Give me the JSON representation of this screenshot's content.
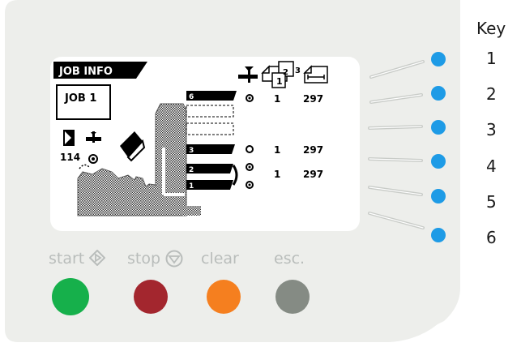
{
  "lcd": {
    "header": "JOB INFO",
    "job_name": "JOB  1",
    "counter": "114",
    "rows": [
      {
        "station": "6",
        "qty": "1",
        "size": "297"
      },
      {
        "station": "3",
        "qty": "1",
        "size": "297"
      },
      {
        "station": "2-1",
        "qty": "1",
        "size": "297"
      }
    ],
    "tray_labels": [
      "6",
      "3",
      "2",
      "1"
    ]
  },
  "buttons": {
    "start_label": "start",
    "stop_label": "stop",
    "clear_label": "clear",
    "esc_label": "esc.",
    "start_color": "#16b04b",
    "stop_color": "#a3262e",
    "clear_color": "#f57f1f",
    "esc_color": "#858b84"
  },
  "key": {
    "title": "Key",
    "items": [
      "1",
      "2",
      "3",
      "4",
      "5",
      "6"
    ],
    "led_color": "#1e9be6"
  },
  "panel_color": "#edeeeb"
}
